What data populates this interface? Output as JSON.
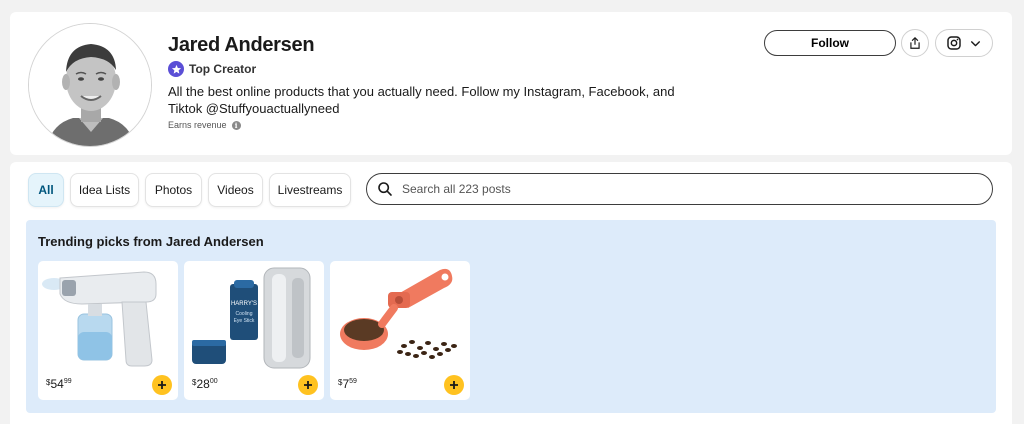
{
  "profile": {
    "name": "Jared Andersen",
    "badge": "Top Creator",
    "bio": "All the best online products that you actually need. Follow my Instagram, Facebook, and Tiktok @Stuffyouactuallyneed",
    "earns_label": "Earns revenue",
    "info_glyph": "i"
  },
  "actions": {
    "follow_label": "Follow",
    "share_icon": "share-icon",
    "social_icon": "instagram-icon",
    "menu_icon": "chevron-down-icon"
  },
  "filters": {
    "tabs": [
      {
        "label": "All",
        "active": true
      },
      {
        "label": "Idea Lists",
        "active": false
      },
      {
        "label": "Photos",
        "active": false
      },
      {
        "label": "Videos",
        "active": false
      },
      {
        "label": "Livestreams",
        "active": false
      }
    ]
  },
  "search": {
    "placeholder": "Search all 223 posts"
  },
  "trending": {
    "title": "Trending picks from Jared Andersen",
    "products": [
      {
        "currency": "$",
        "dollars": "54",
        "cents": "99",
        "image": "sanitizer-spray-gun"
      },
      {
        "currency": "$",
        "dollars": "28",
        "cents": "00",
        "image": "cooling-eye-stick",
        "image_text": [
          "HARRY'S",
          "Cooling",
          "Eye Stick"
        ]
      },
      {
        "currency": "$",
        "dollars": "7",
        "cents": "59",
        "image": "coffee-scoop"
      }
    ]
  },
  "colors": {
    "accent_yellow": "#ffc220",
    "trending_bg": "#ddebfa",
    "active_tab_bg": "#e5f4fb",
    "badge_purple": "#5b4fd6"
  }
}
